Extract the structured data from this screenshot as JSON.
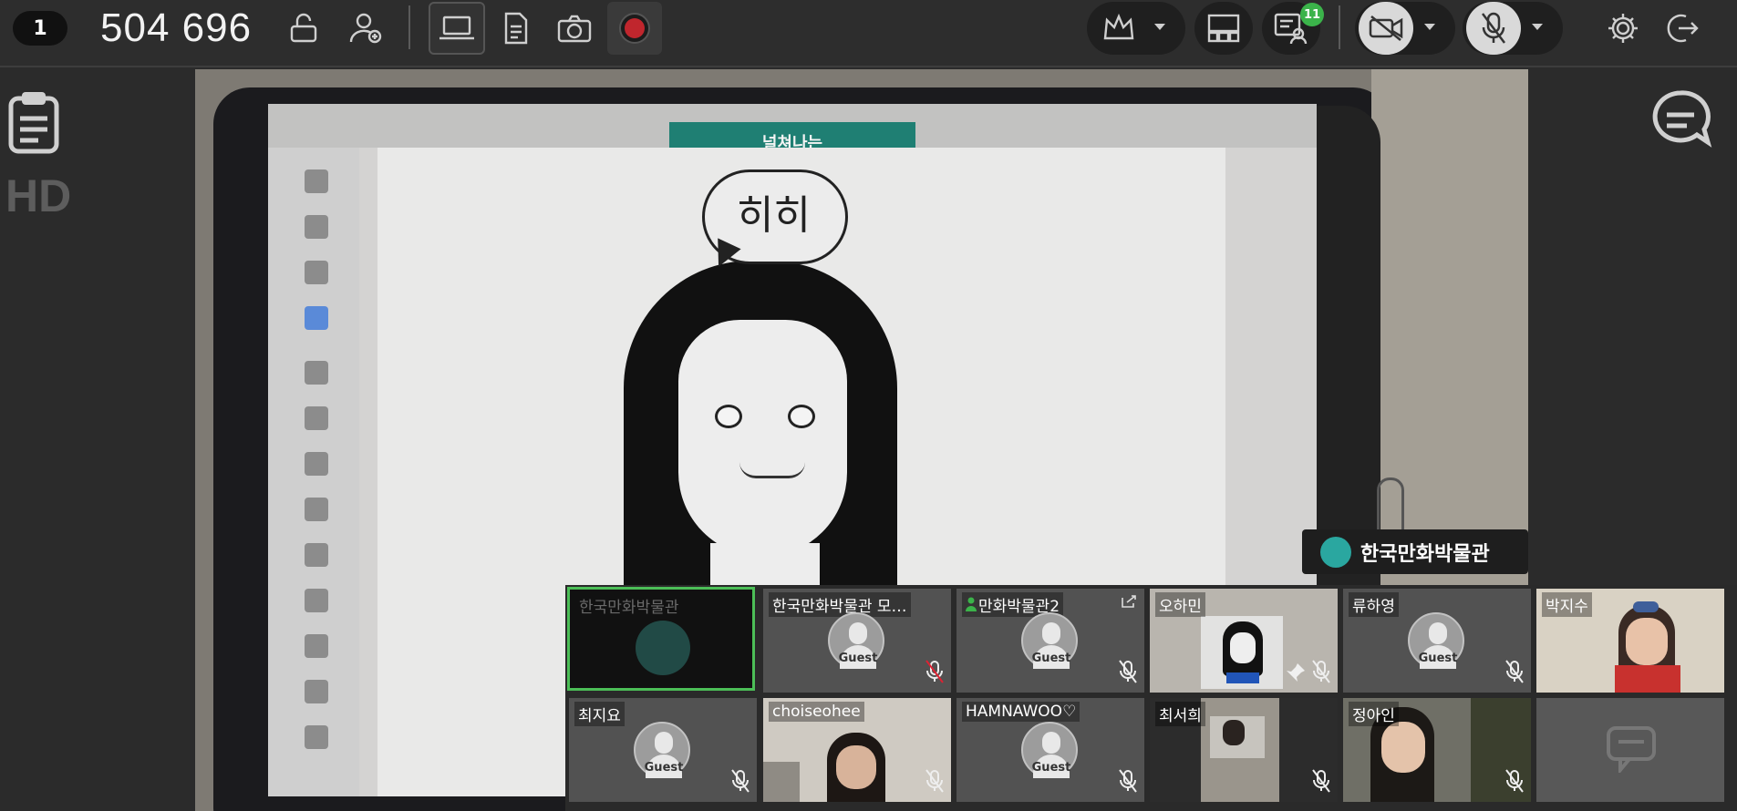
{
  "toolbar": {
    "room_number": "1",
    "room_id": "504 696",
    "icons": {
      "unlock": "unlock-icon",
      "add_user": "add-user-icon",
      "screen_share": "laptop-icon",
      "document": "document-icon",
      "camera": "camera-icon",
      "record": "record-icon",
      "host": "crown-icon",
      "layout": "layout-icon",
      "participants": "participants-icon",
      "video_off": "video-off-icon",
      "mic_off": "mic-off-icon",
      "settings": "gear-icon",
      "exit": "exit-icon"
    },
    "participants_badge": "11"
  },
  "left_panel": {
    "quality_label": "HD"
  },
  "main_video": {
    "banner_text": "널쳐나는",
    "speech_bubble": "히히",
    "speaker_name": "한국만화박물관"
  },
  "participants": [
    {
      "name": "한국만화박물관",
      "type": "screen"
    },
    {
      "name": "한국만화박물관 모…",
      "type": "guest",
      "avatar_label": "Guest"
    },
    {
      "name": "만화박물관2",
      "type": "guest",
      "avatar_label": "Guest"
    },
    {
      "name": "오하민",
      "type": "camera"
    },
    {
      "name": "류하영",
      "type": "guest",
      "avatar_label": "Guest"
    },
    {
      "name": "박지수",
      "type": "camera"
    },
    {
      "name": "최지요",
      "type": "guest",
      "avatar_label": "Guest"
    },
    {
      "name": "choiseohee",
      "type": "camera"
    },
    {
      "name": "HAMNAWOO♡",
      "type": "guest",
      "avatar_label": "Guest"
    },
    {
      "name": "최서희",
      "type": "camera"
    },
    {
      "name": "정아인",
      "type": "camera"
    }
  ],
  "colors": {
    "toolbar_bg": "#2d2d2d",
    "active_tile_border": "#4cbe57",
    "badge_green": "#3bb34a",
    "record_red": "#c0262d"
  }
}
